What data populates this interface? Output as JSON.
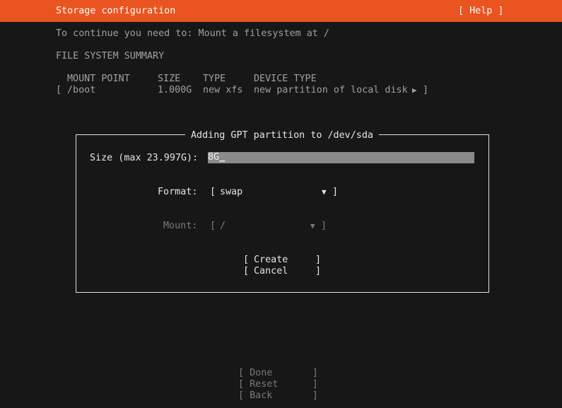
{
  "header": {
    "title": "Storage configuration",
    "help": "[ Help ]"
  },
  "notice": "To continue you need to: Mount a filesystem at /",
  "summary": {
    "heading": "FILE SYSTEM SUMMARY",
    "columns": {
      "mount_point": "MOUNT POINT",
      "size": "SIZE",
      "type": "TYPE",
      "device_type": "DEVICE TYPE"
    },
    "rows": [
      {
        "open_bracket": "[",
        "mount_point": "/boot",
        "size": "1.000G",
        "type": "new xfs",
        "device_type": "new partition of local disk",
        "arrow": "▶",
        "close_bracket": "]"
      }
    ]
  },
  "dialog": {
    "title": "Adding GPT partition to /dev/sda",
    "size_label": "Size (max 23.997G):",
    "size_value": "8G",
    "size_cursor": "_",
    "format_label": "Format:",
    "format_open": "[",
    "format_value": "swap",
    "format_arrow": "▼",
    "format_close": "]",
    "mount_label": "Mount:",
    "mount_open": "[",
    "mount_value": "/",
    "mount_arrow": "▼",
    "mount_close": "]",
    "create_open": "[",
    "create_label": "Create",
    "create_close": "]",
    "cancel_open": "[",
    "cancel_label": "Cancel",
    "cancel_close": "]"
  },
  "actions": {
    "done": "[ Done       ]",
    "reset": "[ Reset      ]",
    "back": "[ Back       ]"
  },
  "colors": {
    "header_bg": "#e95420",
    "background": "#171717",
    "field_bg": "#8a8a8a"
  }
}
